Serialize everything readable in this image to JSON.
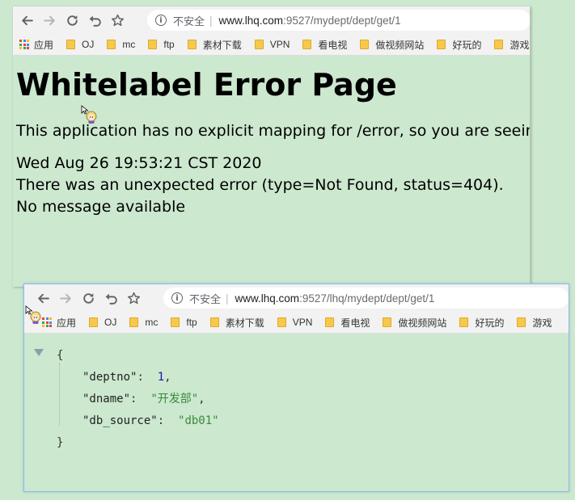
{
  "bookmarks": [
    {
      "label": "应用",
      "icon": "apps-grid-icon"
    },
    {
      "label": "OJ",
      "icon": "folder-icon"
    },
    {
      "label": "mc",
      "icon": "folder-icon"
    },
    {
      "label": "ftp",
      "icon": "folder-icon"
    },
    {
      "label": "素材下载",
      "icon": "folder-icon"
    },
    {
      "label": "VPN",
      "icon": "folder-icon"
    },
    {
      "label": "看电视",
      "icon": "folder-icon"
    },
    {
      "label": "做视频网站",
      "icon": "folder-icon"
    },
    {
      "label": "好玩的",
      "icon": "folder-icon"
    },
    {
      "label": "游戏",
      "icon": "folder-icon"
    }
  ],
  "window1": {
    "address": {
      "security_label": "不安全",
      "url_host": "www.lhq.com",
      "url_rest": ":9527/mydept/dept/get/1"
    },
    "page": {
      "title": "Whitelabel Error Page",
      "description": "This application has no explicit mapping for /error, so you are seeing this as a fallback.",
      "timestamp": "Wed Aug 26 19:53:21 CST 2020",
      "error": "There was an unexpected error (type=Not Found, status=404).",
      "message": "No message available"
    }
  },
  "window2": {
    "address": {
      "security_label": "不安全",
      "url_host": "www.lhq.com",
      "url_rest": ":9527/lhq/mydept/dept/get/1"
    },
    "json": {
      "open_brace": "{",
      "close_brace": "}",
      "fields": [
        {
          "key": "\"deptno\"",
          "value": "1",
          "type": "number",
          "comma": ","
        },
        {
          "key": "\"dname\"",
          "value": "\"开发部\"",
          "type": "string",
          "comma": ","
        },
        {
          "key": "\"db_source\"",
          "value": "\"db01\"",
          "type": "string",
          "comma": ""
        }
      ]
    }
  },
  "colors": {
    "background": "#cce8cf",
    "toolbar": "#f2f2f2",
    "json_number": "#1a1aa6",
    "json_string": "#3a8a3a",
    "folder": "#f6c94a",
    "active_border": "#8fbde6"
  }
}
